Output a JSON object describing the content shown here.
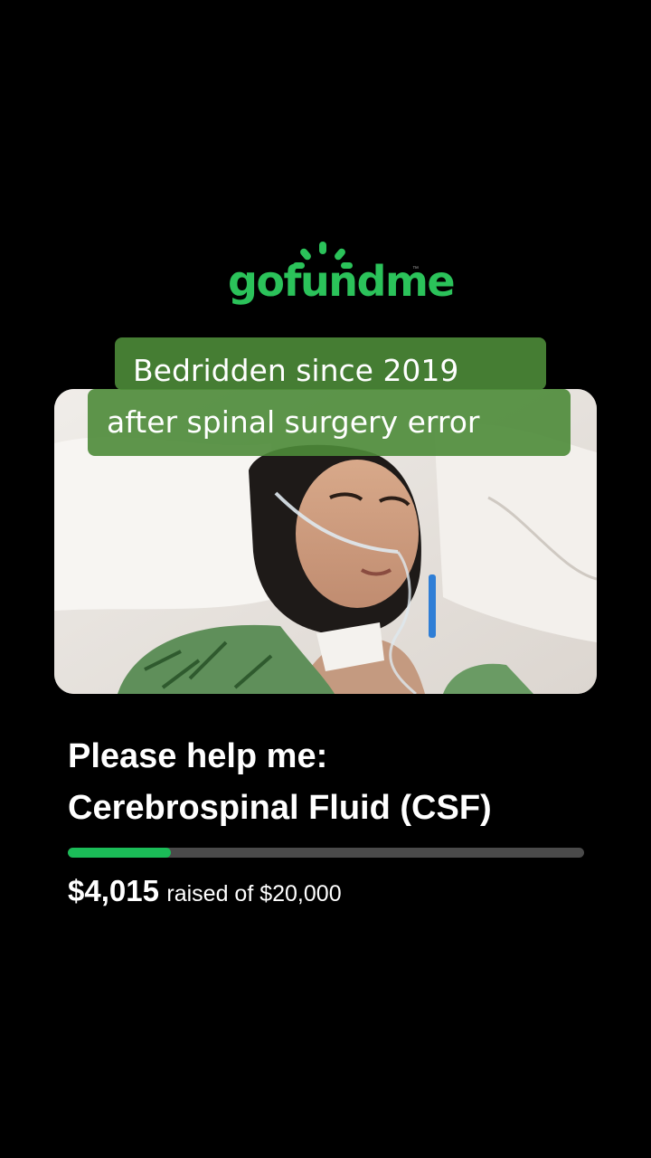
{
  "brand": {
    "name": "gofundme",
    "trademark": "™",
    "color": "#2bc25a"
  },
  "captions": {
    "line1": "Bedridden since 2019",
    "line2": "after spinal surgery error",
    "background": "#4c8b38"
  },
  "campaign": {
    "title_line1": "Please help me:",
    "title_line2": "Cerebrospinal Fluid (CSF)",
    "raised_amount": "$4,015",
    "raised_text": "raised of $20,000",
    "progress_percent": 20,
    "progress_color": "#1bbc58"
  }
}
